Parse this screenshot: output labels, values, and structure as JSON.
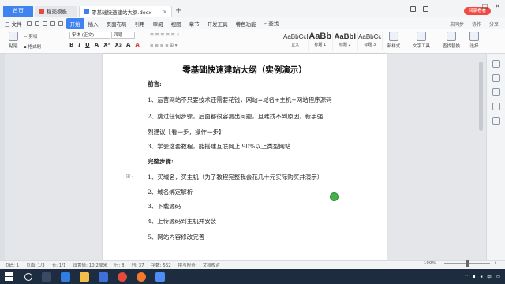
{
  "titlebar": {
    "home_tab": "首页",
    "tabs": [
      {
        "label": "稻壳模板",
        "icon": "daoke-icon"
      },
      {
        "label": "零基础快速建站大纲.docx",
        "icon": "doc-icon"
      }
    ],
    "user_button": "回家看看"
  },
  "menu": {
    "file": "三 文件",
    "items": [
      "开始",
      "插入",
      "页面布局",
      "引用",
      "审阅",
      "视图",
      "章节",
      "开发工具",
      "特色功能"
    ],
    "active": "开始",
    "search": "查找",
    "right": [
      "未同步",
      "协作",
      "分享"
    ]
  },
  "ribbon": {
    "paste": "粘贴",
    "cut": "剪切",
    "format_painter": "格式刷",
    "font_name": "宋体 (正文)",
    "font_size": "四号",
    "format_buttons": [
      "B",
      "I",
      "U",
      "A",
      "X²",
      "X₂",
      "A",
      "A"
    ],
    "styles": [
      {
        "sample": "AaBbCcDd",
        "name": "正文",
        "cls": ""
      },
      {
        "sample": "AaBb",
        "name": "标题 1",
        "cls": "big"
      },
      {
        "sample": "AaBbl",
        "name": "标题 2",
        "cls": "mid"
      },
      {
        "sample": "AaBbCc",
        "name": "标题 3",
        "cls": ""
      }
    ],
    "new_style": "新样式",
    "text_tools": "文字工具",
    "find_replace": "查找替换",
    "select": "选择"
  },
  "document": {
    "title": "零基础快速建站大纲（实例演示）",
    "paragraphs": [
      {
        "text": "前言:",
        "style": "bold"
      },
      {
        "text": "1、运营网站不只要技术还需要花钱，网站=域名+主机+网站程序源码",
        "style": ""
      },
      {
        "text": "2、跳过任何步骤，后面都很容易出问题，且难找不到原因，新手强",
        "style": ""
      },
      {
        "text": "烈建议【看一步，操作一步】",
        "style": ""
      },
      {
        "text": "3、学会这套教程，能搭建互联网上 90%以上类型网站",
        "style": ""
      },
      {
        "text": "完整步骤:",
        "style": "bold"
      },
      {
        "text": "1、买域名，买主机（为了教程完整我会花几十元实际购买并演示）",
        "style": ""
      },
      {
        "text": "2、域名绑定解析",
        "style": ""
      },
      {
        "text": "3、下载源码",
        "style": ""
      },
      {
        "text": "4、上传源码到主机并安装",
        "style": ""
      },
      {
        "text": "5、网站内容修改完善",
        "style": ""
      }
    ],
    "margin_marker": "⊞ -"
  },
  "statusbar": {
    "items": [
      "页码: 1",
      "页面: 1/3",
      "节: 1/1",
      "设置值: 10.2厘米",
      "行: 8",
      "列: 37",
      "字数: 562",
      "拼写检查",
      "文档校对"
    ],
    "zoom": "100%",
    "zoom_level": 0.5
  },
  "taskbar": {
    "icons": [
      "search-icon",
      "task-view-icon",
      "edge-icon",
      "explorer-icon",
      "store-icon",
      "chrome-icon",
      "firefox-icon",
      "wps-icon"
    ],
    "time": "",
    "date": ""
  }
}
